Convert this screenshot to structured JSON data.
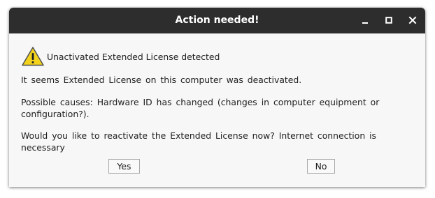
{
  "window": {
    "title": "Action needed!",
    "controls": {
      "minimize_icon": "minimize-icon",
      "maximize_icon": "maximize-icon",
      "close_icon": "close-icon"
    }
  },
  "message": {
    "icon": "warning-icon",
    "heading": "Unactivated Extended License detected",
    "line1": "It seems  Extended  License  on this computer  was deactivated.",
    "line2": "Possible  causes:  Hardware ID has changed  (changes  in computer equipment  or configuration?).",
    "line3": "Would  you like to reactivate  the Extended  License  now?  Internet connection  is necessary"
  },
  "buttons": {
    "yes": "Yes",
    "no": "No"
  },
  "colors": {
    "titlebar": "#2d2d2d",
    "dialog_bg": "#f7f7f7",
    "warning_yellow": "#f3d21e"
  }
}
